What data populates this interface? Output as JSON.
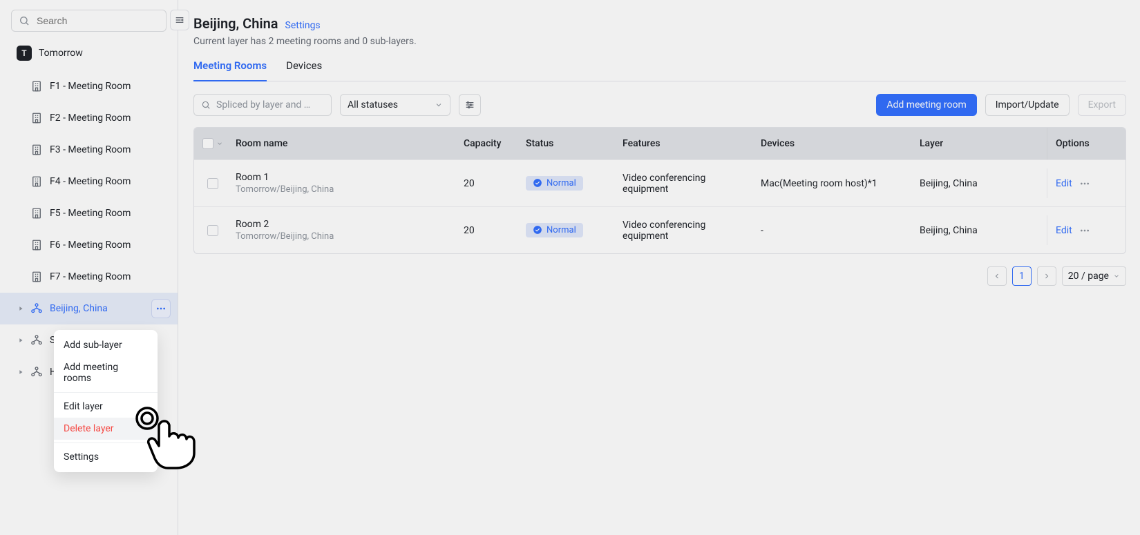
{
  "sidebar": {
    "search_placeholder": "Search",
    "root_label": "Tomorrow",
    "root_badge": "T",
    "items": [
      {
        "label": "F1 - Meeting Room",
        "type": "room"
      },
      {
        "label": "F2 - Meeting Room",
        "type": "room"
      },
      {
        "label": "F3 - Meeting Room",
        "type": "room"
      },
      {
        "label": "F4 - Meeting Room",
        "type": "room"
      },
      {
        "label": "F5 - Meeting Room",
        "type": "room"
      },
      {
        "label": "F6 - Meeting Room",
        "type": "room"
      },
      {
        "label": "F7 - Meeting Room",
        "type": "room"
      },
      {
        "label": "Beijing, China",
        "type": "layer",
        "active": true,
        "has_caret": true
      },
      {
        "label": "S",
        "type": "layer",
        "has_caret": true
      },
      {
        "label": "H",
        "type": "layer",
        "has_caret": true
      }
    ]
  },
  "context_menu": {
    "items": [
      {
        "label": "Add sub-layer"
      },
      {
        "label": "Add meeting rooms"
      },
      {
        "sep": true
      },
      {
        "label": "Edit layer"
      },
      {
        "label": "Delete layer",
        "danger": true,
        "hover": true
      },
      {
        "sep": true
      },
      {
        "label": "Settings"
      }
    ]
  },
  "header": {
    "title": "Beijing, China",
    "settings_label": "Settings",
    "subtitle": "Current layer has 2 meeting rooms and 0 sub-layers."
  },
  "tabs": [
    {
      "label": "Meeting Rooms",
      "active": true
    },
    {
      "label": "Devices",
      "active": false
    }
  ],
  "toolbar": {
    "splice_placeholder": "Spliced by layer and …",
    "status_label": "All statuses",
    "add_room": "Add meeting room",
    "import_update": "Import/Update",
    "export": "Export"
  },
  "table": {
    "columns": [
      "Room name",
      "Capacity",
      "Status",
      "Features",
      "Devices",
      "Layer",
      "Options"
    ],
    "rows": [
      {
        "name": "Room 1",
        "path": "Tomorrow/Beijing, China",
        "capacity": "20",
        "status": "Normal",
        "features": "Video conferencing equipment",
        "devices": "Mac(Meeting room host)*1",
        "layer": "Beijing, China",
        "edit": "Edit"
      },
      {
        "name": "Room 2",
        "path": "Tomorrow/Beijing, China",
        "capacity": "20",
        "status": "Normal",
        "features": "Video conferencing equipment",
        "devices": "-",
        "layer": "Beijing, China",
        "edit": "Edit"
      }
    ]
  },
  "pagination": {
    "current": "1",
    "page_size_label": "20 / page"
  }
}
